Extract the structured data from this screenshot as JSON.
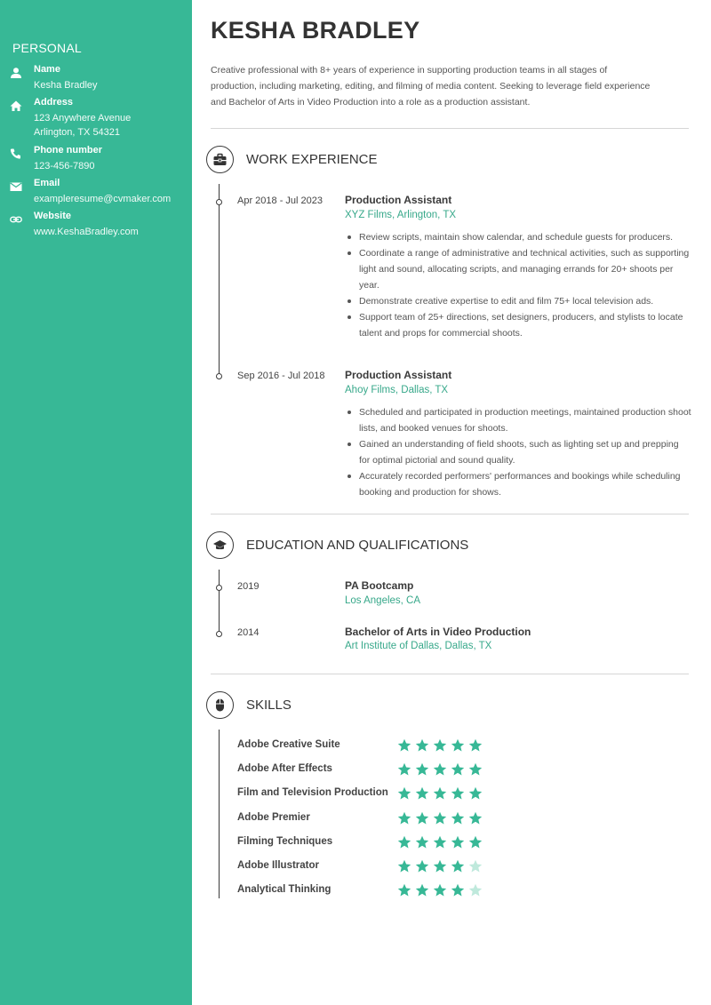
{
  "sidebar": {
    "title": "PERSONAL",
    "items": [
      {
        "icon": "person-icon",
        "label": "Name",
        "value": [
          "Kesha Bradley"
        ]
      },
      {
        "icon": "home-icon",
        "label": "Address",
        "value": [
          "123 Anywhere Avenue",
          "Arlington, TX 54321"
        ]
      },
      {
        "icon": "phone-icon",
        "label": "Phone number",
        "value": [
          "123-456-7890"
        ]
      },
      {
        "icon": "email-icon",
        "label": "Email",
        "value": [
          "exampleresume@cvmaker.com"
        ]
      },
      {
        "icon": "link-icon",
        "label": "Website",
        "value": [
          "www.KeshaBradley.com"
        ]
      }
    ]
  },
  "header": {
    "name": "KESHA BRADLEY",
    "summary": "Creative professional with 8+ years of experience in supporting production teams in all stages of production, including marketing, editing, and filming of media content. Seeking to leverage field experience and Bachelor of Arts in Video Production into a role as a production assistant."
  },
  "work": {
    "title": "WORK EXPERIENCE",
    "icon": "briefcase-icon",
    "jobs": [
      {
        "date": "Apr 2018 - Jul 2023",
        "title": "Production Assistant",
        "company": "XYZ Films, Arlington, TX",
        "bullets": [
          "Review scripts, maintain show calendar, and schedule guests for producers.",
          "Coordinate a range of administrative and technical activities, such as supporting light and sound, allocating scripts, and managing errands for 20+ shoots per year.",
          "Demonstrate creative expertise to edit and film 75+ local television ads.",
          "Support team of 25+ directions, set designers, producers, and stylists to locate talent and props for commercial shoots."
        ]
      },
      {
        "date": "Sep 2016 - Jul 2018",
        "title": "Production Assistant",
        "company": "Ahoy Films, Dallas, TX",
        "bullets": [
          "Scheduled and participated in production meetings, maintained production shoot lists, and booked venues for shoots.",
          "Gained an understanding of field shoots, such as lighting set up and prepping for optimal pictorial and sound quality.",
          "Accurately recorded performers' performances and bookings while scheduling booking and production for shows."
        ]
      }
    ]
  },
  "education": {
    "title": "EDUCATION AND QUALIFICATIONS",
    "icon": "graduation-cap-icon",
    "items": [
      {
        "date": "2019",
        "title": "PA Bootcamp",
        "place": "Los Angeles, CA"
      },
      {
        "date": "2014",
        "title": "Bachelor of Arts in Video Production",
        "place": "Art Institute of Dallas, Dallas, TX"
      }
    ]
  },
  "skills": {
    "title": "SKILLS",
    "icon": "mouse-icon",
    "max_rating": 5,
    "items": [
      {
        "name": "Adobe Creative Suite",
        "rating": 5
      },
      {
        "name": "Adobe After Effects",
        "rating": 5
      },
      {
        "name": "Film and Television Production",
        "rating": 5
      },
      {
        "name": "Adobe Premier",
        "rating": 5
      },
      {
        "name": "Filming Techniques",
        "rating": 5
      },
      {
        "name": "Adobe Illustrator",
        "rating": 4
      },
      {
        "name": "Analytical Thinking",
        "rating": 4
      }
    ]
  },
  "colors": {
    "sidebar_bg": "#37b896",
    "accent": "#37a88a",
    "star_filled": "#37b896",
    "star_empty": "#bfe9dc",
    "text_dark": "#333333"
  }
}
